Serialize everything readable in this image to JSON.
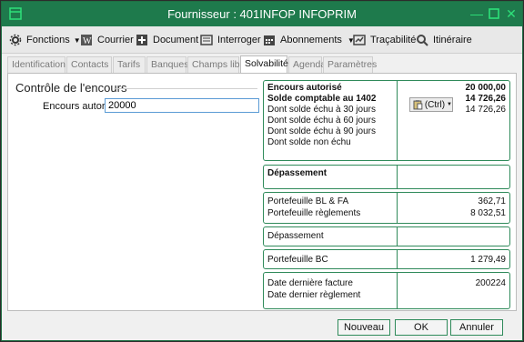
{
  "window": {
    "title": "Fournisseur : 401INFOP INFOPRIM"
  },
  "toolbar": {
    "fonctions": "Fonctions",
    "courrier": "Courrier",
    "document": "Document",
    "interroger": "Interroger",
    "abonnements": "Abonnements",
    "tracabilite": "Traçabilité",
    "itineraire": "Itinéraire"
  },
  "tabs": [
    "Identification",
    "Contacts",
    "Tarifs",
    "Banques",
    "Champs libres",
    "Solvabilité",
    "Agenda",
    "Paramètres"
  ],
  "active_tab": "Solvabilité",
  "encours": {
    "section_title": "Contrôle de l'encours",
    "label": "Encours autorisé",
    "value": "20000"
  },
  "summary": {
    "lines": [
      {
        "label": "Encours autorisé",
        "value": "20 000,00",
        "bold": true
      },
      {
        "label": "Solde comptable au 1402",
        "value": "14 726,26",
        "bold": true
      },
      {
        "label": "Dont solde échu à 30 jours",
        "value": "14 726,26",
        "bold": false
      },
      {
        "label": "Dont solde échu à 60 jours",
        "value": "",
        "bold": false
      },
      {
        "label": "Dont solde échu à 90 jours",
        "value": "",
        "bold": false
      },
      {
        "label": "Dont solde non échu",
        "value": "",
        "bold": false
      }
    ],
    "paste_label": "(Ctrl)"
  },
  "depassement1": "Dépassement",
  "portefeuille": {
    "bl_fa_label": "Portefeuille BL & FA",
    "bl_fa_value": "362,71",
    "reglements_label": "Portefeuille règlements",
    "reglements_value": "8 032,51"
  },
  "depassement2": "Dépassement",
  "portefeuille_bc": {
    "label": "Portefeuille BC",
    "value": "1 279,49"
  },
  "dates": {
    "facture_label": "Date dernière facture",
    "facture_value": "200224",
    "reglement_label": "Date dernier règlement",
    "reglement_value": ""
  },
  "buttons": {
    "nouveau": "Nouveau",
    "ok": "OK",
    "annuler": "Annuler"
  },
  "colors": {
    "titlebar": "#1e7a4c",
    "accent": "#2f8a5a"
  }
}
